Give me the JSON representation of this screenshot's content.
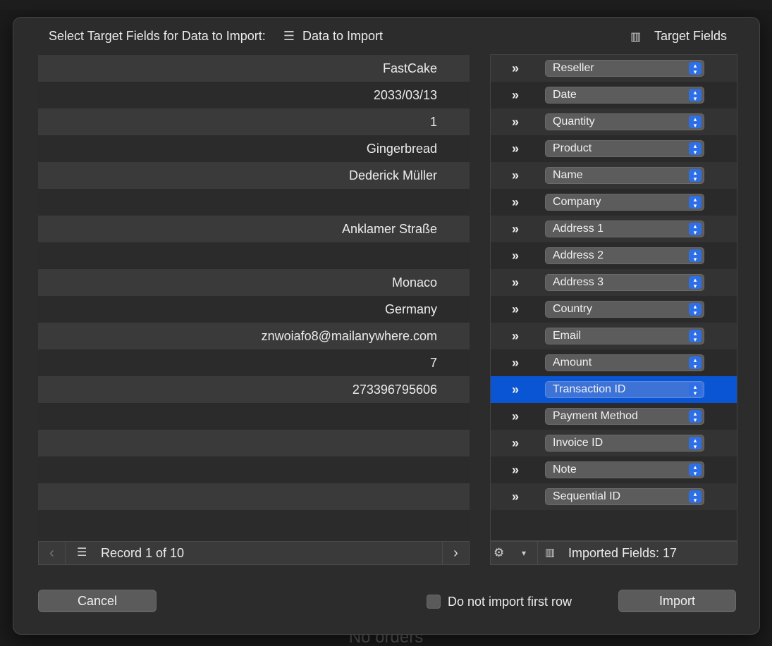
{
  "background": {
    "footer_text": "No orders"
  },
  "header": {
    "prompt": "Select Target Fields for Data to Import:",
    "data_icon": "list-icon",
    "data_label": "Data to Import",
    "target_icon": "columns-icon",
    "target_label": "Target Fields"
  },
  "data_rows": [
    "FastCake",
    "2033/03/13",
    "1",
    "Gingerbread",
    "Dederick Müller",
    "",
    "Anklamer Straße",
    "",
    "Monaco",
    "Germany",
    "znwoiafo8@mailanywhere.com",
    "7",
    "273396795606",
    "",
    "",
    "",
    "",
    ""
  ],
  "target_rows": [
    {
      "arrow": "»",
      "field": "Reseller"
    },
    {
      "arrow": "»",
      "field": "Date"
    },
    {
      "arrow": "»",
      "field": "Quantity"
    },
    {
      "arrow": "»",
      "field": "Product"
    },
    {
      "arrow": "»",
      "field": "Name"
    },
    {
      "arrow": "»",
      "field": "Company"
    },
    {
      "arrow": "»",
      "field": "Address 1"
    },
    {
      "arrow": "»",
      "field": "Address 2"
    },
    {
      "arrow": "»",
      "field": "Address 3"
    },
    {
      "arrow": "»",
      "field": "Country"
    },
    {
      "arrow": "»",
      "field": "Email"
    },
    {
      "arrow": "»",
      "field": "Amount"
    },
    {
      "arrow": "»",
      "field": "Transaction ID",
      "selected": true
    },
    {
      "arrow": "»",
      "field": "Payment Method"
    },
    {
      "arrow": "»",
      "field": "Invoice ID"
    },
    {
      "arrow": "»",
      "field": "Note"
    },
    {
      "arrow": "»",
      "field": "Sequential ID"
    }
  ],
  "left_footer": {
    "prev_icon": "chevron-left-icon",
    "next_icon": "chevron-right-icon",
    "record_label": "Record 1 of 10"
  },
  "right_footer": {
    "gear_icon": "gear-icon",
    "imported_label": "Imported Fields: 17"
  },
  "buttons": {
    "cancel": "Cancel",
    "import": "Import",
    "checkbox_label": "Do not import first row",
    "checkbox_checked": false
  },
  "colors": {
    "selected_row": "#0a55d4",
    "stepper": "#2f6fe6"
  }
}
